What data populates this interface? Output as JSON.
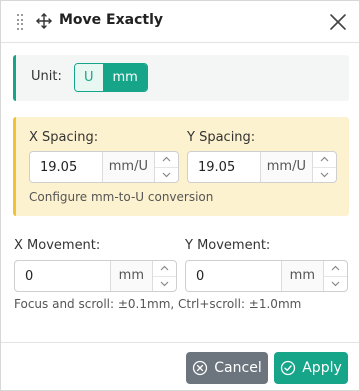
{
  "dialog": {
    "title": "Move Exactly",
    "icons": {
      "drag": "drag-handle-icon",
      "title": "move-arrows-icon",
      "close": "close-icon"
    }
  },
  "unit": {
    "label": "Unit:",
    "options": [
      "U",
      "mm"
    ],
    "selected": "mm"
  },
  "spacing": {
    "x_label": "X Spacing:",
    "x_value": "19.05",
    "x_unit": "mm/U",
    "y_label": "Y Spacing:",
    "y_value": "19.05",
    "y_unit": "mm/U",
    "hint": "Configure mm-to-U conversion"
  },
  "movement": {
    "x_label": "X Movement:",
    "x_value": "0",
    "x_unit": "mm",
    "y_label": "Y Movement:",
    "y_value": "0",
    "y_unit": "mm",
    "hint": "Focus and scroll: ±0.1mm, Ctrl+scroll: ±1.0mm"
  },
  "footer": {
    "cancel_label": "Cancel",
    "apply_label": "Apply"
  },
  "colors": {
    "accent": "#17a589",
    "warning_bg": "#fdf2cf",
    "warning_border": "#f2c230",
    "secondary": "#6c757d"
  }
}
